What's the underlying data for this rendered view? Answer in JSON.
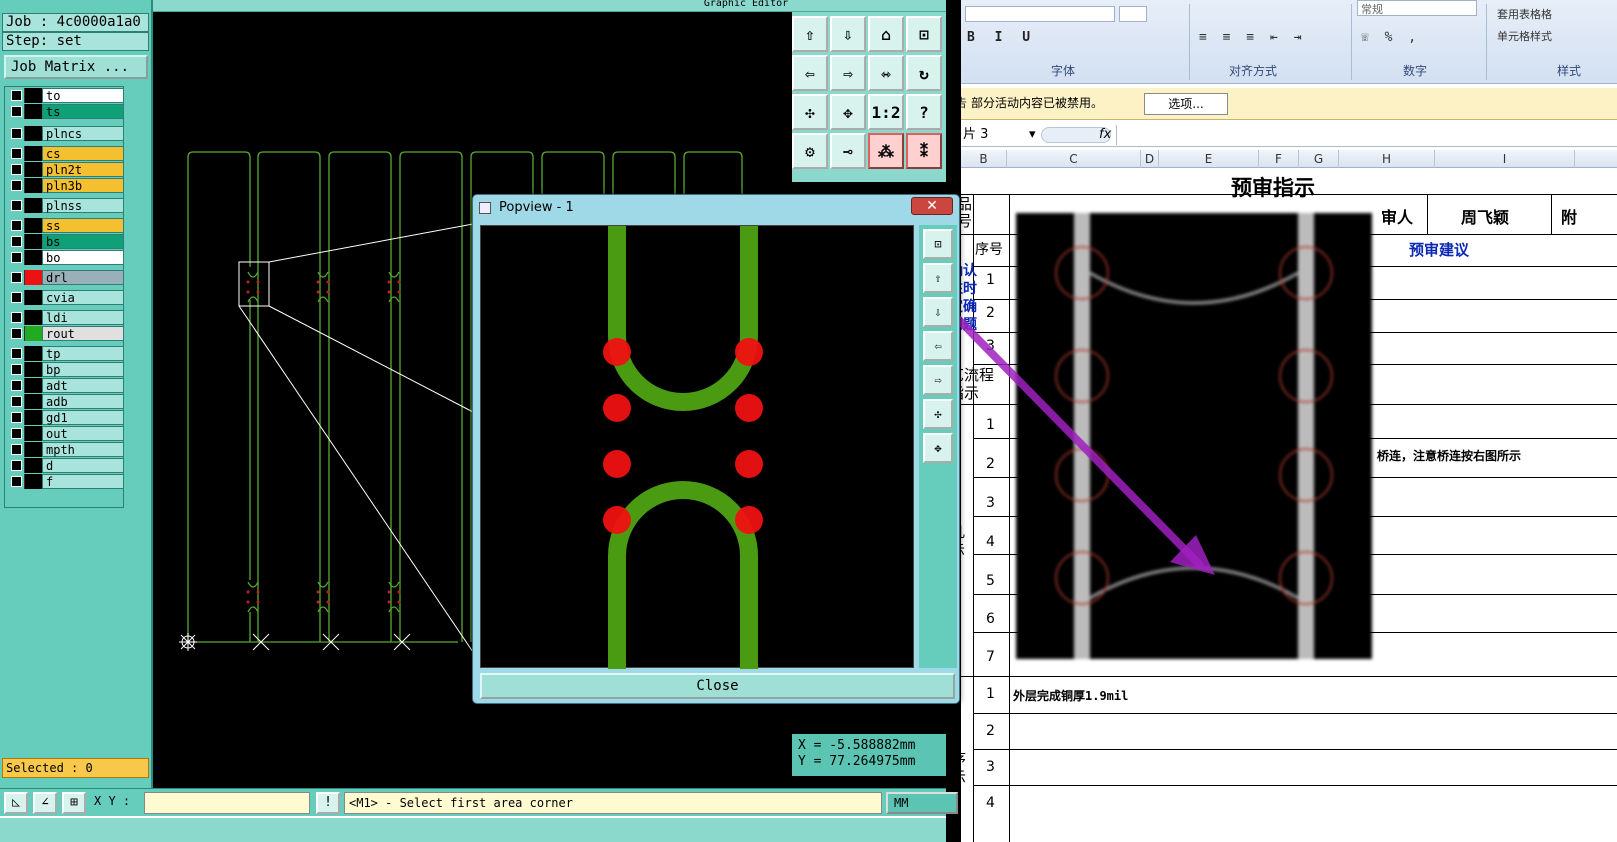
{
  "genesis": {
    "job_label": "Job : 4c0000a1a0",
    "step_label": "Step: set",
    "matrix_button": "Job Matrix ...",
    "graphic_editor_title": "Graphic Editor",
    "layers": [
      {
        "name": "to",
        "color": "#ffffff"
      },
      {
        "name": "ts",
        "color": "#10a078"
      },
      {
        "name": "plncs",
        "color": "#a8e4dc"
      },
      {
        "name": "cs",
        "color": "#f4c030"
      },
      {
        "name": "pln2t",
        "color": "#f4c030"
      },
      {
        "name": "pln3b",
        "color": "#f4c030"
      },
      {
        "name": "plnss",
        "color": "#a8e4dc"
      },
      {
        "name": "ss",
        "color": "#f4c030"
      },
      {
        "name": "bs",
        "color": "#10a078"
      },
      {
        "name": "bo",
        "color": "#ffffff"
      },
      {
        "name": "drl",
        "color": "#9ab0b8"
      },
      {
        "name": "cvia",
        "color": "#a8e4dc"
      },
      {
        "name": "ldi",
        "color": "#a8e4dc"
      },
      {
        "name": "rout",
        "color": "#e0e0e0"
      },
      {
        "name": "tp",
        "color": "#a8e4dc"
      },
      {
        "name": "bp",
        "color": "#a8e4dc"
      },
      {
        "name": "adt",
        "color": "#a8e4dc"
      },
      {
        "name": "adb",
        "color": "#a8e4dc"
      },
      {
        "name": "gd1",
        "color": "#a8e4dc"
      },
      {
        "name": "out",
        "color": "#a8e4dc"
      },
      {
        "name": "mpth",
        "color": "#a8e4dc"
      },
      {
        "name": "d",
        "color": "#a8e4dc"
      },
      {
        "name": "f",
        "color": "#a8e4dc"
      }
    ],
    "selected": "Selected : 0",
    "coord_x": "X  =  -5.588882mm",
    "coord_y": "Y  =  77.264975mm",
    "xy_label": "X Y :",
    "prompt_message": "<M1> - Select first area corner",
    "unit": "MM",
    "toolbar_ratio": "1:2",
    "toolbar_help": "?"
  },
  "popview": {
    "title": "Popview - 1",
    "close_button": "Close"
  },
  "excel": {
    "font_group": "字体",
    "align_group": "对齐方式",
    "number_group": "数字",
    "style_group": "样式",
    "number_format": "常规",
    "table_format": "套用表格格",
    "cell_style": "单元格样式",
    "security_notice": "部分活动内容已被禁用。",
    "notice_prefix": "告",
    "options_button": "选项...",
    "name_box": "片 3",
    "fx": "fx",
    "columns": [
      "B",
      "C",
      "D",
      "E",
      "F",
      "G",
      "H",
      "I"
    ],
    "sheet_title": "预审指示",
    "reviewer_header": "审人",
    "reviewer_name": "周飞颖",
    "col_extra": "附",
    "seq_header": "序号",
    "suggestion_header": "预审建议",
    "product_label": "品\n号",
    "confirm_label": "确认\n注时\n定确\n问题",
    "process_label": "艺流程\n指示",
    "section3_label": "凡\n示",
    "section4_label": "序\n示",
    "row_numbers_a": [
      "1",
      "2",
      "3"
    ],
    "row_numbers_b": [
      "1",
      "2",
      "3",
      "4",
      "5",
      "6",
      "7"
    ],
    "row_numbers_c": [
      "1",
      "2",
      "3",
      "4"
    ],
    "bridge_note": "桥连，注意桥连按右图所示",
    "copper_note": "外层完成铜厚1.9mil"
  }
}
